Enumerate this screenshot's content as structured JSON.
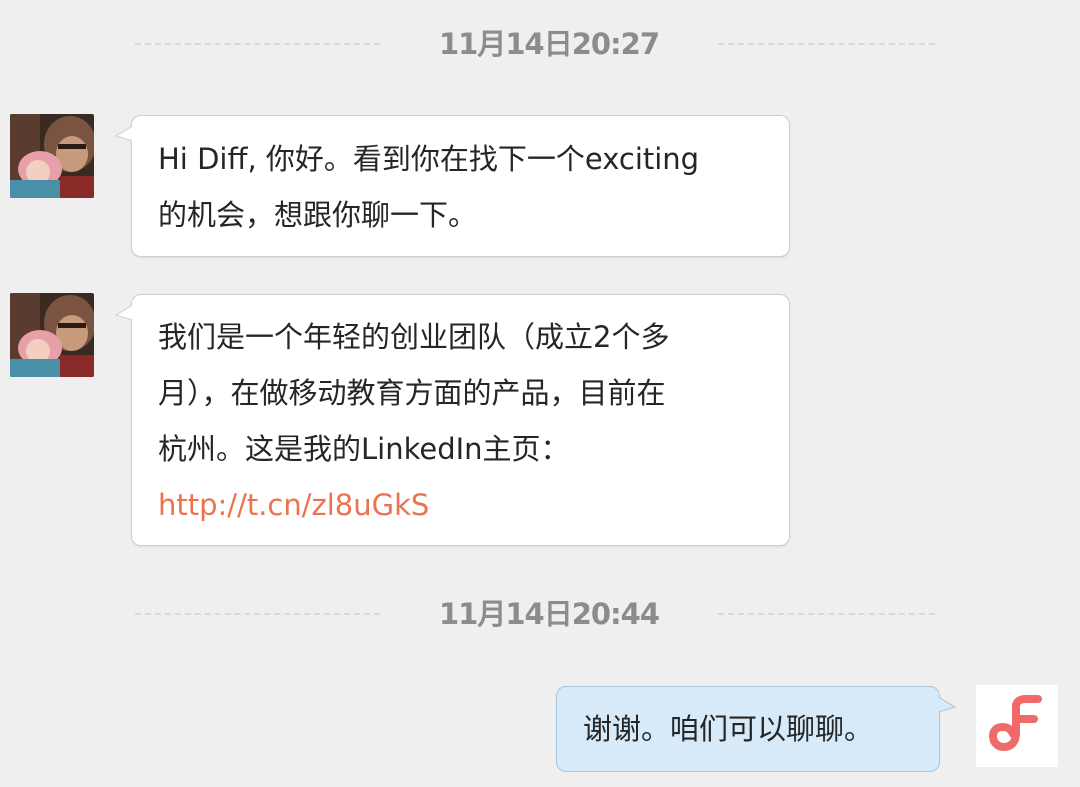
{
  "chat": {
    "dividers": [
      {
        "time": "11月14日20:27"
      },
      {
        "time": "11月14日20:44"
      }
    ],
    "messages": [
      {
        "sender": "other",
        "lines": [
          "Hi Diff, 你好。看到你在找下一个exciting",
          "的机会，想跟你聊一下。"
        ]
      },
      {
        "sender": "other",
        "lines": [
          "我们是一个年轻的创业团队（成立2个多",
          "月），在做移动教育方面的产品，目前在",
          "杭州。这是我的LinkedIn主页："
        ],
        "link": "http://t.cn/zl8uGkS"
      },
      {
        "sender": "me",
        "lines": [
          "谢谢。咱们可以聊聊。"
        ]
      }
    ]
  },
  "colors": {
    "background": "#efefef",
    "incoming_bubble": "#ffffff",
    "outgoing_bubble": "#d6eafa",
    "link": "#eb7350",
    "timestamp": "#8c8c8c",
    "app_logo": "#f06a6a"
  },
  "icons": {
    "other_avatar": "user-photo-avatar",
    "my_avatar": "app-logo-avatar"
  }
}
